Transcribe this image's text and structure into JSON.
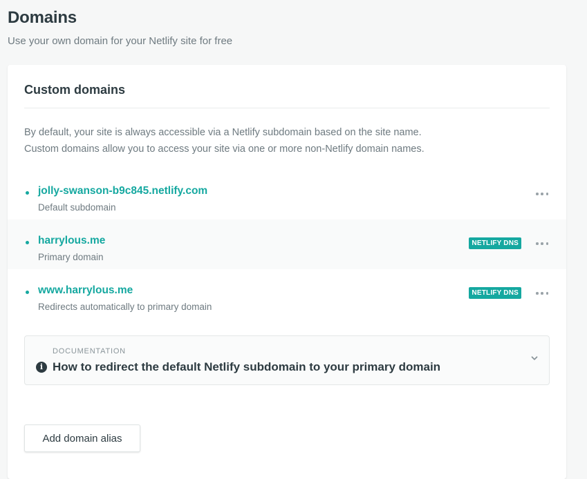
{
  "page": {
    "title": "Domains",
    "subtitle": "Use your own domain for your Netlify site for free"
  },
  "card": {
    "heading": "Custom domains",
    "description": [
      "By default, your site is always accessible via a Netlify subdomain based on the site name.",
      "Custom domains allow you to access your site via one or more non-Netlify domain names."
    ]
  },
  "domains": [
    {
      "name": "jolly-swanson-b9c845.netlify.com",
      "description": "Default subdomain",
      "badge": "",
      "more_icon": "more-horizontal-icon"
    },
    {
      "name": "harrylous.me",
      "description": "Primary domain",
      "badge": "NETLIFY DNS",
      "more_icon": "more-horizontal-icon"
    },
    {
      "name": "www.harrylous.me",
      "description": "Redirects automatically to primary domain",
      "badge": "NETLIFY DNS",
      "more_icon": "more-horizontal-icon"
    }
  ],
  "documentation": {
    "label": "DOCUMENTATION",
    "title": "How to redirect the default Netlify subdomain to your primary domain",
    "icon": "info-icon",
    "toggle_icon": "chevron-down-icon"
  },
  "actions": {
    "add_alias_label": "Add domain alias"
  },
  "colors": {
    "accent": "#15a8a0",
    "text": "#2d3b41",
    "muted": "#6e7a80",
    "background": "#f6f7f7"
  }
}
